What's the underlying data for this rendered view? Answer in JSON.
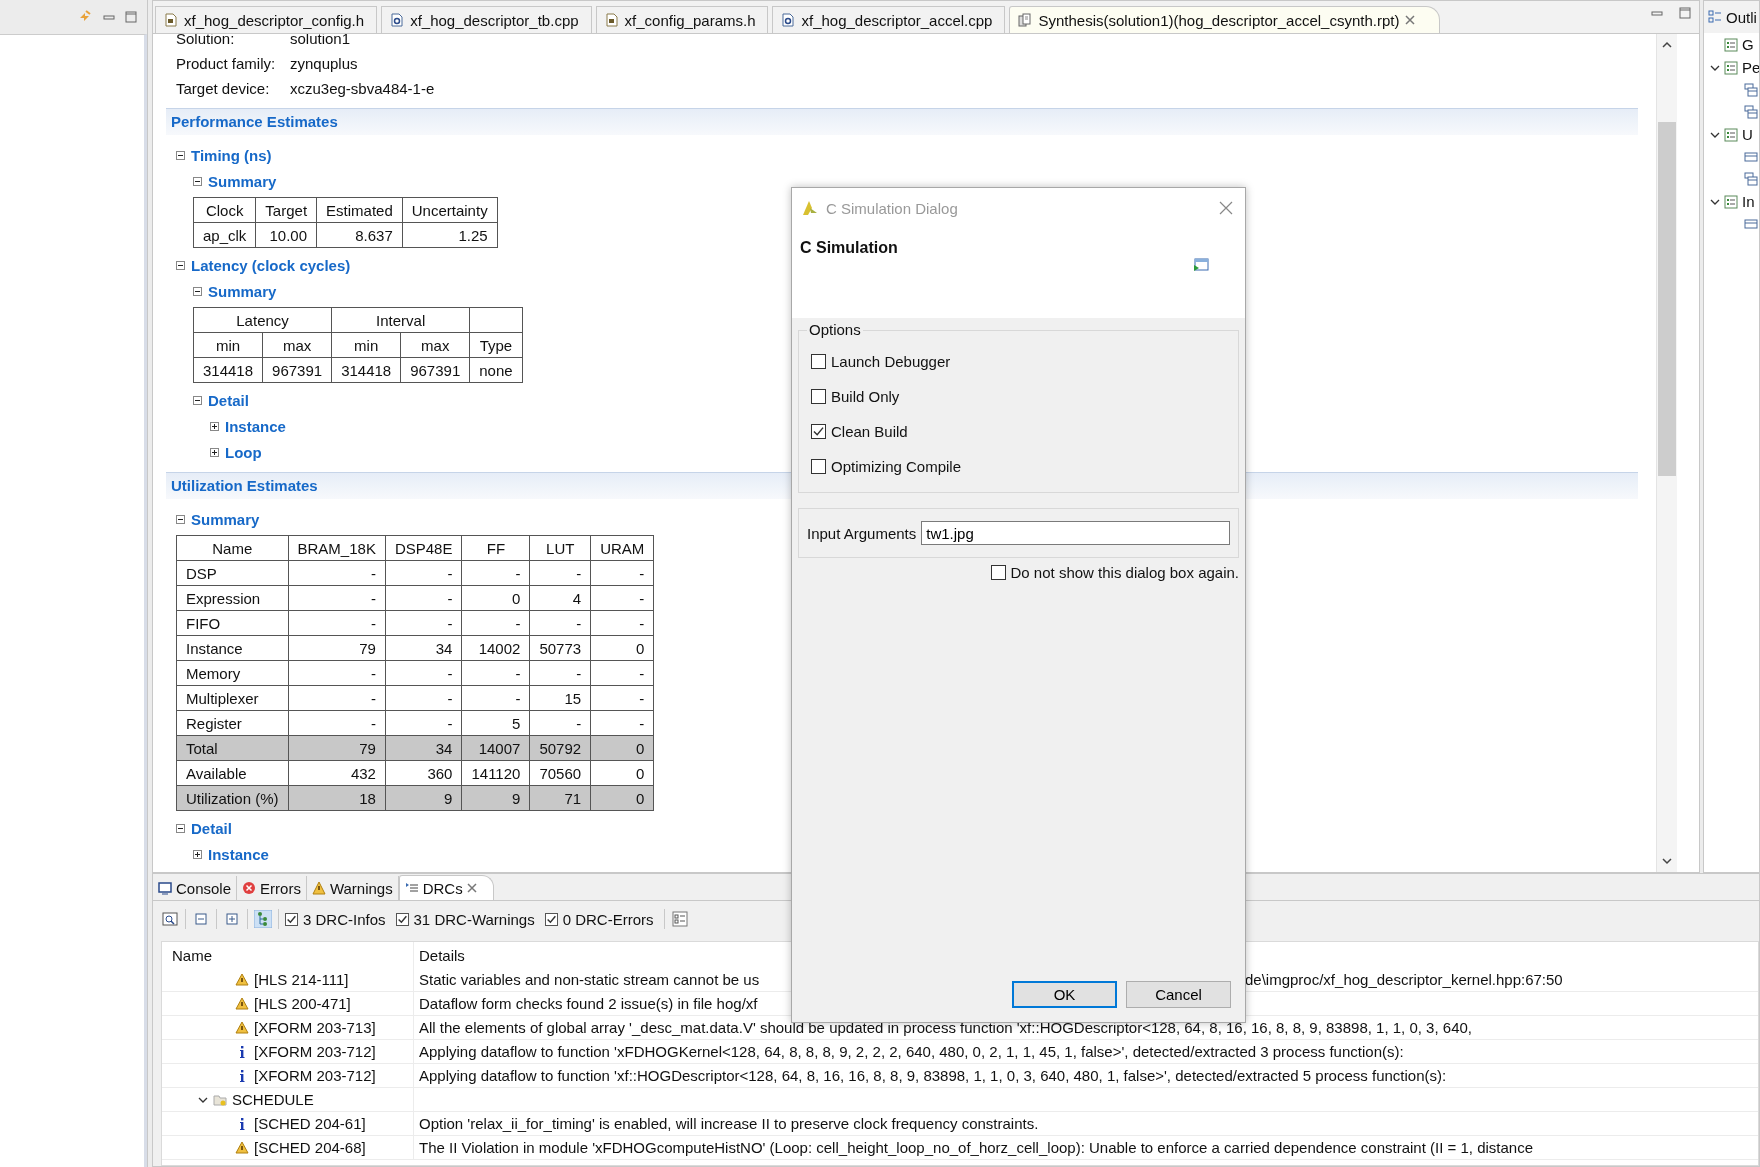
{
  "editor_tabs": [
    {
      "label": "xf_hog_descriptor_config.h",
      "kind": "header",
      "selected": false
    },
    {
      "label": "xf_hog_descriptor_tb.cpp",
      "kind": "source",
      "selected": false
    },
    {
      "label": "xf_config_params.h",
      "kind": "header",
      "selected": false
    },
    {
      "label": "xf_hog_descriptor_accel.cpp",
      "kind": "source",
      "selected": false
    },
    {
      "label": "Synthesis(solution1)(hog_descriptor_accel_csynth.rpt)",
      "kind": "report",
      "selected": true
    }
  ],
  "report": {
    "info": [
      {
        "label": "Solution:",
        "value": "solution1"
      },
      {
        "label": "Product family:",
        "value": "zynquplus"
      },
      {
        "label": "Target device:",
        "value": "xczu3eg-sbva484-1-e"
      }
    ],
    "sections": [
      {
        "title": "Performance Estimates",
        "children": [
          {
            "title": "Timing (ns)",
            "expanded": true,
            "children": [
              {
                "title": "Summary",
                "expanded": true,
                "table": {
                  "header_rows": [
                    [
                      {
                        "text": "Clock"
                      },
                      {
                        "text": "Target"
                      },
                      {
                        "text": "Estimated"
                      },
                      {
                        "text": "Uncertainty"
                      }
                    ]
                  ],
                  "rows": [
                    {
                      "highlighted": false,
                      "cells": [
                        "ap_clk",
                        "10.00",
                        "8.637",
                        "1.25"
                      ]
                    }
                  ]
                }
              }
            ]
          },
          {
            "title": "Latency (clock cycles)",
            "expanded": true,
            "children": [
              {
                "title": "Summary",
                "expanded": true,
                "table": {
                  "header_rows": [
                    [
                      {
                        "text": "Latency",
                        "kind": "group"
                      },
                      {
                        "text": "Interval",
                        "kind": "group"
                      },
                      {
                        "kind": "blank"
                      }
                    ],
                    [
                      {
                        "text": "min"
                      },
                      {
                        "text": "max"
                      },
                      {
                        "text": "min"
                      },
                      {
                        "text": "max"
                      },
                      {
                        "text": "Type"
                      }
                    ]
                  ],
                  "rows": [
                    {
                      "highlighted": false,
                      "cells": [
                        "314418",
                        "967391",
                        "314418",
                        "967391",
                        "none"
                      ]
                    }
                  ]
                }
              },
              {
                "title": "Detail",
                "expanded": true,
                "children": [
                  {
                    "title": "Instance",
                    "expanded": false
                  },
                  {
                    "title": "Loop",
                    "expanded": false
                  }
                ]
              }
            ]
          }
        ]
      },
      {
        "title": "Utilization Estimates",
        "children": [
          {
            "title": "Summary",
            "expanded": true,
            "table": {
              "header_rows": [
                [
                  {
                    "text": "Name"
                  },
                  {
                    "text": "BRAM_18K"
                  },
                  {
                    "text": "DSP48E"
                  },
                  {
                    "text": "FF"
                  },
                  {
                    "text": "LUT"
                  },
                  {
                    "text": "URAM"
                  }
                ]
              ],
              "rows": [
                {
                  "highlighted": false,
                  "cells": [
                    "DSP",
                    "-",
                    "-",
                    "-",
                    "-",
                    "-"
                  ]
                },
                {
                  "highlighted": false,
                  "cells": [
                    "Expression",
                    "-",
                    "-",
                    "0",
                    "4",
                    "-"
                  ]
                },
                {
                  "highlighted": false,
                  "cells": [
                    "FIFO",
                    "-",
                    "-",
                    "-",
                    "-",
                    "-"
                  ]
                },
                {
                  "highlighted": false,
                  "cells": [
                    "Instance",
                    "79",
                    "34",
                    "14002",
                    "50773",
                    "0"
                  ]
                },
                {
                  "highlighted": false,
                  "cells": [
                    "Memory",
                    "-",
                    "-",
                    "-",
                    "-",
                    "-"
                  ]
                },
                {
                  "highlighted": false,
                  "cells": [
                    "Multiplexer",
                    "-",
                    "-",
                    "-",
                    "15",
                    "-"
                  ]
                },
                {
                  "highlighted": false,
                  "cells": [
                    "Register",
                    "-",
                    "-",
                    "5",
                    "-",
                    "-"
                  ]
                },
                {
                  "highlighted": true,
                  "cells": [
                    "Total",
                    "79",
                    "34",
                    "14007",
                    "50792",
                    "0"
                  ]
                },
                {
                  "highlighted": false,
                  "cells": [
                    "Available",
                    "432",
                    "360",
                    "141120",
                    "70560",
                    "0"
                  ]
                },
                {
                  "highlighted": true,
                  "cells": [
                    "Utilization (%)",
                    "18",
                    "9",
                    "9",
                    "71",
                    "0"
                  ]
                }
              ]
            }
          },
          {
            "title": "Detail",
            "expanded": true,
            "children": [
              {
                "title": "Instance",
                "expanded": false
              }
            ]
          }
        ]
      }
    ]
  },
  "outline": {
    "tab": "Outli",
    "items": [
      {
        "label": "G"
      },
      {
        "label": "Pe",
        "expanded": true,
        "children": [
          {
            "kind": "table"
          },
          {
            "kind": "table"
          }
        ]
      },
      {
        "label": "U",
        "expanded": true,
        "children": [
          {
            "kind": "list"
          },
          {
            "kind": "table"
          }
        ]
      },
      {
        "label": "In",
        "expanded": true,
        "children": [
          {
            "kind": "list"
          }
        ]
      }
    ]
  },
  "bottom_tabs": [
    {
      "label": "Console",
      "kind": "console",
      "selected": false
    },
    {
      "label": "Errors",
      "kind": "errors",
      "selected": false
    },
    {
      "label": "Warnings",
      "kind": "warnings",
      "selected": false
    },
    {
      "label": "DRCs",
      "kind": "drcs",
      "selected": true
    }
  ],
  "filters": [
    {
      "label": "3 DRC-Infos",
      "checked": true
    },
    {
      "label": "31 DRC-Warnings",
      "checked": true
    },
    {
      "label": "0 DRC-Errors",
      "checked": true
    }
  ],
  "drc_table": {
    "columns": [
      "Name",
      "Details"
    ],
    "groups": [
      {
        "children": [
          {
            "kind": "warning",
            "name": "[HLS 214-111]",
            "details": "Static variables and non-static stream cannot be us",
            "details_tail": "de\\imgproc/xf_hog_descriptor_kernel.hpp:67:50"
          },
          {
            "kind": "warning",
            "name": "[HLS 200-471]",
            "details": "Dataflow form checks found 2 issue(s) in file hog/xf"
          },
          {
            "kind": "warning",
            "name": "[XFORM 203-713]",
            "details": "All the elements of global array '_desc_mat.data.V' should be updated in process function 'xf::HOGDescriptor<128, 64, 8, 16, 16, 8, 8, 9, 83898, 1, 1, 0, 3, 640,"
          },
          {
            "kind": "info",
            "name": "[XFORM 203-712]",
            "details": "Applying dataflow to function 'xFDHOGKernel<128, 64, 8, 8, 8, 9, 2, 2, 2, 640, 480, 0, 2, 1, 1, 45, 1, false>', detected/extracted 3 process function(s):"
          },
          {
            "kind": "info",
            "name": "[XFORM 203-712]",
            "details": "Applying dataflow to function 'xf::HOGDescriptor<128, 64, 8, 16, 16, 8, 8, 9, 83898, 1, 1, 0, 3, 640, 480, 1, false>', detected/extracted 5 process function(s):"
          }
        ]
      },
      {
        "name": "SCHEDULE",
        "expanded": true,
        "children": [
          {
            "kind": "info",
            "name": "[SCHED 204-61]",
            "details": "Option 'relax_ii_for_timing' is enabled, will increase II to preserve clock frequency constraints."
          },
          {
            "kind": "warning",
            "name": "[SCHED 204-68]",
            "details": "The II Violation in module 'xFDHOGcomputeHistNO' (Loop: cell_height_loop_no_of_horz_cell_loop): Unable to enforce a carried dependence constraint (II = 1, distance"
          }
        ]
      }
    ]
  },
  "dialog": {
    "title": "C Simulation Dialog",
    "heading": "C Simulation",
    "group_label": "Options",
    "options": [
      {
        "label": "Launch Debugger",
        "checked": false
      },
      {
        "label": "Build Only",
        "checked": false
      },
      {
        "label": "Clean Build",
        "checked": true
      },
      {
        "label": "Optimizing Compile",
        "checked": false
      }
    ],
    "input": {
      "label": "Input Arguments",
      "value": "tw1.jpg"
    },
    "dont_show": {
      "label": "Do not show this dialog box again.",
      "checked": false
    },
    "buttons": [
      {
        "label": "OK",
        "default": true
      },
      {
        "label": "Cancel",
        "default": false
      }
    ]
  }
}
